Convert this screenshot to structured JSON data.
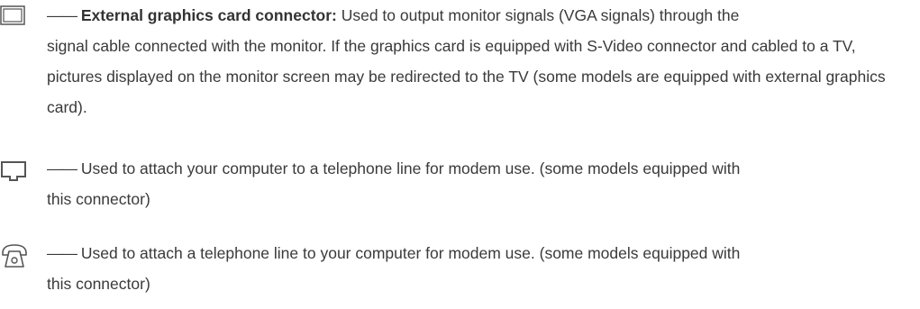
{
  "entries": [
    {
      "icon": "monitor-port-icon",
      "dash": "——",
      "term": "External graphics card connector:",
      "line1": " Used to output monitor signals (VGA signals) through the",
      "rest": "signal cable connected with the monitor. If the graphics card is equipped with S-Video connector and cabled to a TV, pictures displayed on the monitor screen may be redirected to the TV (some models are equipped with external graphics card)."
    },
    {
      "icon": "modem-port-icon",
      "dash": "——",
      "line1": " Used to attach your computer to a telephone line for modem use. (some models equipped with",
      "rest": "this connector)"
    },
    {
      "icon": "telephone-icon",
      "dash": "——",
      "line1": " Used to attach a telephone line to your computer for modem use. (some models equipped with",
      "rest": "this connector)"
    }
  ]
}
